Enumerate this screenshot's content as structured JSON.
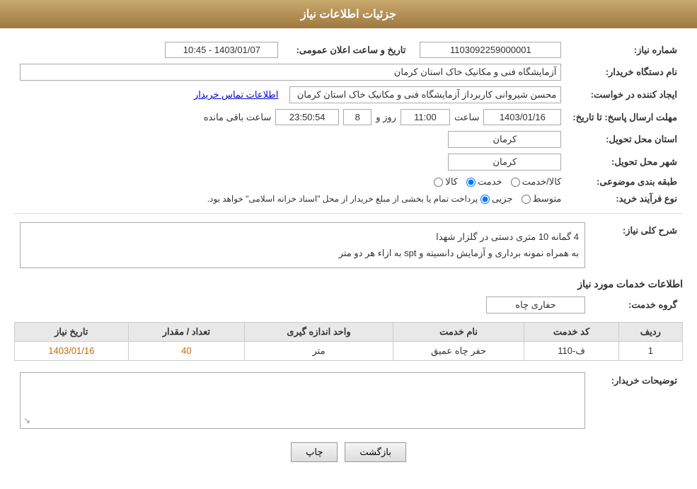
{
  "header": {
    "title": "جزئیات اطلاعات نیاز"
  },
  "fields": {
    "need_number_label": "شماره نیاز:",
    "need_number_value": "1103092259000001",
    "buyer_org_label": "نام دستگاه خریدار:",
    "buyer_org_value": "آزمایشگاه فنی و مکانیک خاک استان کرمان",
    "announcement_date_label": "تاریخ و ساعت اعلان عمومی:",
    "announcement_date_value": "1403/01/07 - 10:45",
    "creator_label": "ایجاد کننده در خواست:",
    "creator_value": "محسن شیروانی کاربرداز آزمایشگاه فنی و مکانیک خاک استان کرمان",
    "contact_link": "اطلاعات تماس خریدار",
    "deadline_label": "مهلت ارسال پاسخ: تا تاریخ:",
    "deadline_date": "1403/01/16",
    "deadline_time": "11:00",
    "deadline_days": "8",
    "deadline_remaining": "23:50:54",
    "deadline_remaining_label": "ساعت باقی مانده",
    "deadline_day_label": "روز و",
    "deadline_time_label": "ساعت",
    "province_label": "استان محل تحویل:",
    "province_value": "کرمان",
    "city_label": "شهر محل تحویل:",
    "city_value": "کرمان",
    "category_label": "طبقه بندی موضوعی:",
    "category_options": [
      "کالا",
      "خدمت",
      "کالا/خدمت"
    ],
    "category_selected": "خدمت",
    "purchase_type_label": "نوع فرآیند خرید:",
    "purchase_type_options": [
      "جزیی",
      "متوسط"
    ],
    "purchase_type_note": "پرداخت تمام یا بخشی از مبلغ خریدار از محل \"اسناد خزانه اسلامی\" خواهد بود.",
    "description_label": "شرح کلی نیاز:",
    "description_text": "4 گمانه 10 متری دستی در گلزار شهدا\nبه همراه نمونه برداری و آزمایش دانسیته و spt به ازاء هر دو متر",
    "services_label": "اطلاعات خدمات مورد نیاز",
    "service_group_label": "گروه خدمت:",
    "service_group_value": "حفاری چاه",
    "table": {
      "headers": [
        "ردیف",
        "کد خدمت",
        "نام خدمت",
        "واحد اندازه گیری",
        "تعداد / مقدار",
        "تاریخ نیاز"
      ],
      "rows": [
        {
          "row_num": "1",
          "service_code": "ف-110",
          "service_name": "حفر چاه عمیق",
          "unit": "متر",
          "quantity": "40",
          "date": "1403/01/16"
        }
      ]
    },
    "buyer_notes_label": "توضیحات خریدار:"
  },
  "buttons": {
    "print": "چاپ",
    "back": "بازگشت"
  }
}
